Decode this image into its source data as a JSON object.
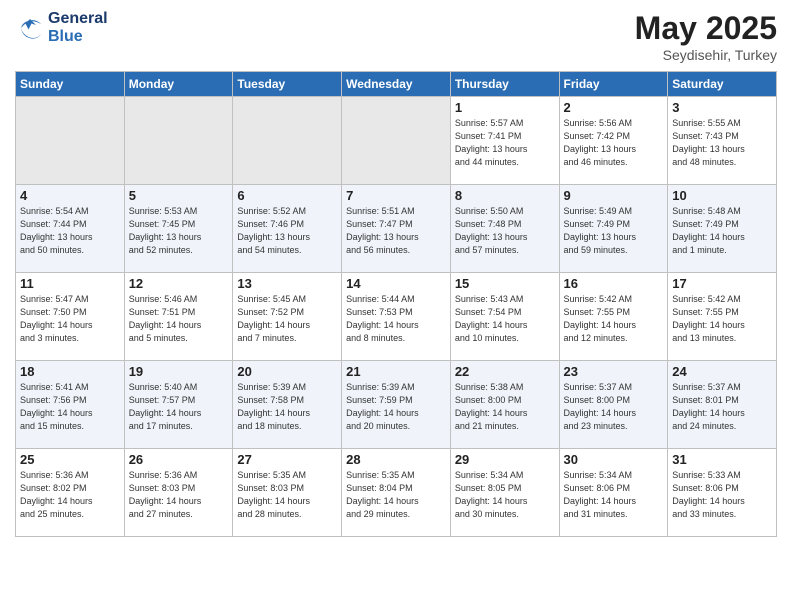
{
  "header": {
    "logo_line1": "General",
    "logo_line2": "Blue",
    "month": "May 2025",
    "location": "Seydisehir, Turkey"
  },
  "days_of_week": [
    "Sunday",
    "Monday",
    "Tuesday",
    "Wednesday",
    "Thursday",
    "Friday",
    "Saturday"
  ],
  "weeks": [
    [
      {
        "day": "",
        "info": ""
      },
      {
        "day": "",
        "info": ""
      },
      {
        "day": "",
        "info": ""
      },
      {
        "day": "",
        "info": ""
      },
      {
        "day": "1",
        "info": "Sunrise: 5:57 AM\nSunset: 7:41 PM\nDaylight: 13 hours\nand 44 minutes."
      },
      {
        "day": "2",
        "info": "Sunrise: 5:56 AM\nSunset: 7:42 PM\nDaylight: 13 hours\nand 46 minutes."
      },
      {
        "day": "3",
        "info": "Sunrise: 5:55 AM\nSunset: 7:43 PM\nDaylight: 13 hours\nand 48 minutes."
      }
    ],
    [
      {
        "day": "4",
        "info": "Sunrise: 5:54 AM\nSunset: 7:44 PM\nDaylight: 13 hours\nand 50 minutes."
      },
      {
        "day": "5",
        "info": "Sunrise: 5:53 AM\nSunset: 7:45 PM\nDaylight: 13 hours\nand 52 minutes."
      },
      {
        "day": "6",
        "info": "Sunrise: 5:52 AM\nSunset: 7:46 PM\nDaylight: 13 hours\nand 54 minutes."
      },
      {
        "day": "7",
        "info": "Sunrise: 5:51 AM\nSunset: 7:47 PM\nDaylight: 13 hours\nand 56 minutes."
      },
      {
        "day": "8",
        "info": "Sunrise: 5:50 AM\nSunset: 7:48 PM\nDaylight: 13 hours\nand 57 minutes."
      },
      {
        "day": "9",
        "info": "Sunrise: 5:49 AM\nSunset: 7:49 PM\nDaylight: 13 hours\nand 59 minutes."
      },
      {
        "day": "10",
        "info": "Sunrise: 5:48 AM\nSunset: 7:49 PM\nDaylight: 14 hours\nand 1 minute."
      }
    ],
    [
      {
        "day": "11",
        "info": "Sunrise: 5:47 AM\nSunset: 7:50 PM\nDaylight: 14 hours\nand 3 minutes."
      },
      {
        "day": "12",
        "info": "Sunrise: 5:46 AM\nSunset: 7:51 PM\nDaylight: 14 hours\nand 5 minutes."
      },
      {
        "day": "13",
        "info": "Sunrise: 5:45 AM\nSunset: 7:52 PM\nDaylight: 14 hours\nand 7 minutes."
      },
      {
        "day": "14",
        "info": "Sunrise: 5:44 AM\nSunset: 7:53 PM\nDaylight: 14 hours\nand 8 minutes."
      },
      {
        "day": "15",
        "info": "Sunrise: 5:43 AM\nSunset: 7:54 PM\nDaylight: 14 hours\nand 10 minutes."
      },
      {
        "day": "16",
        "info": "Sunrise: 5:42 AM\nSunset: 7:55 PM\nDaylight: 14 hours\nand 12 minutes."
      },
      {
        "day": "17",
        "info": "Sunrise: 5:42 AM\nSunset: 7:55 PM\nDaylight: 14 hours\nand 13 minutes."
      }
    ],
    [
      {
        "day": "18",
        "info": "Sunrise: 5:41 AM\nSunset: 7:56 PM\nDaylight: 14 hours\nand 15 minutes."
      },
      {
        "day": "19",
        "info": "Sunrise: 5:40 AM\nSunset: 7:57 PM\nDaylight: 14 hours\nand 17 minutes."
      },
      {
        "day": "20",
        "info": "Sunrise: 5:39 AM\nSunset: 7:58 PM\nDaylight: 14 hours\nand 18 minutes."
      },
      {
        "day": "21",
        "info": "Sunrise: 5:39 AM\nSunset: 7:59 PM\nDaylight: 14 hours\nand 20 minutes."
      },
      {
        "day": "22",
        "info": "Sunrise: 5:38 AM\nSunset: 8:00 PM\nDaylight: 14 hours\nand 21 minutes."
      },
      {
        "day": "23",
        "info": "Sunrise: 5:37 AM\nSunset: 8:00 PM\nDaylight: 14 hours\nand 23 minutes."
      },
      {
        "day": "24",
        "info": "Sunrise: 5:37 AM\nSunset: 8:01 PM\nDaylight: 14 hours\nand 24 minutes."
      }
    ],
    [
      {
        "day": "25",
        "info": "Sunrise: 5:36 AM\nSunset: 8:02 PM\nDaylight: 14 hours\nand 25 minutes."
      },
      {
        "day": "26",
        "info": "Sunrise: 5:36 AM\nSunset: 8:03 PM\nDaylight: 14 hours\nand 27 minutes."
      },
      {
        "day": "27",
        "info": "Sunrise: 5:35 AM\nSunset: 8:03 PM\nDaylight: 14 hours\nand 28 minutes."
      },
      {
        "day": "28",
        "info": "Sunrise: 5:35 AM\nSunset: 8:04 PM\nDaylight: 14 hours\nand 29 minutes."
      },
      {
        "day": "29",
        "info": "Sunrise: 5:34 AM\nSunset: 8:05 PM\nDaylight: 14 hours\nand 30 minutes."
      },
      {
        "day": "30",
        "info": "Sunrise: 5:34 AM\nSunset: 8:06 PM\nDaylight: 14 hours\nand 31 minutes."
      },
      {
        "day": "31",
        "info": "Sunrise: 5:33 AM\nSunset: 8:06 PM\nDaylight: 14 hours\nand 33 minutes."
      }
    ]
  ]
}
